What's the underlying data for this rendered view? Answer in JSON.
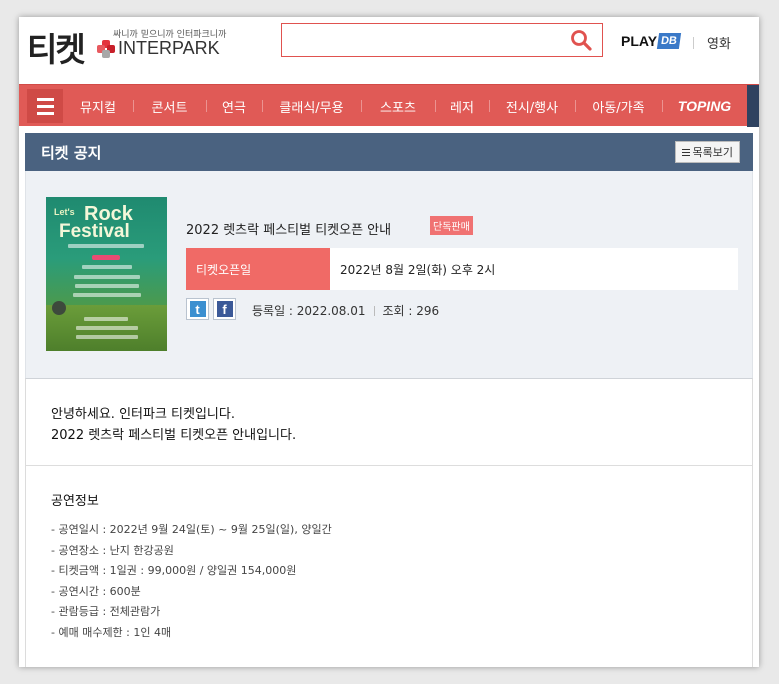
{
  "header": {
    "logo_text": "티켓",
    "logo_tagline": "싸니까 믿으니까 인터파크니까",
    "logo_brand": "INTERPARK",
    "search": {
      "value": "",
      "placeholder": ""
    },
    "playdb_text": "PLAY",
    "playdb_badge": "DB",
    "movie_label": "영화"
  },
  "nav": {
    "items": [
      "뮤지컬",
      "콘서트",
      "연극",
      "클래식/무용",
      "스포츠",
      "레저",
      "전시/행사",
      "아동/가족"
    ],
    "special": "TOPING"
  },
  "notice": {
    "title": "티켓 공지",
    "list_button": "목록보기"
  },
  "poster": {
    "lets": "Let's",
    "rock": "Rock",
    "festival": "Festival"
  },
  "event": {
    "title": "2022 렛츠락 페스티벌 티켓오픈 안내",
    "badge": "단독판매",
    "open_label": "티켓오픈일",
    "open_value": "2022년 8월 2일(화) 오후 2시",
    "registered": "등록일 : 2022.08.01",
    "views": "조회 : 296"
  },
  "content": {
    "intro_line1": "안녕하세요. 인터파크 티켓입니다.",
    "intro_line2": "2022 렛츠락 페스티벌 티켓오픈 안내입니다.",
    "section_title": "공연정보",
    "details": [
      "- 공연일시 : 2022년 9월 24일(토) ~ 9월 25일(일), 양일간",
      "- 공연장소 : 난지 한강공원",
      "- 티켓금액 : 1일권 : 99,000원 / 양일권 154,000원",
      "- 공연시간 : 600분",
      "- 관람등급 : 전체관람가",
      "- 예매 매수제한 : 1인 4매"
    ]
  },
  "colors": {
    "brand_red": "#e05a56",
    "notice_bar": "#4a6280",
    "badge": "#f07272",
    "twitter": "#3b8fd0",
    "facebook": "#3b5998"
  }
}
